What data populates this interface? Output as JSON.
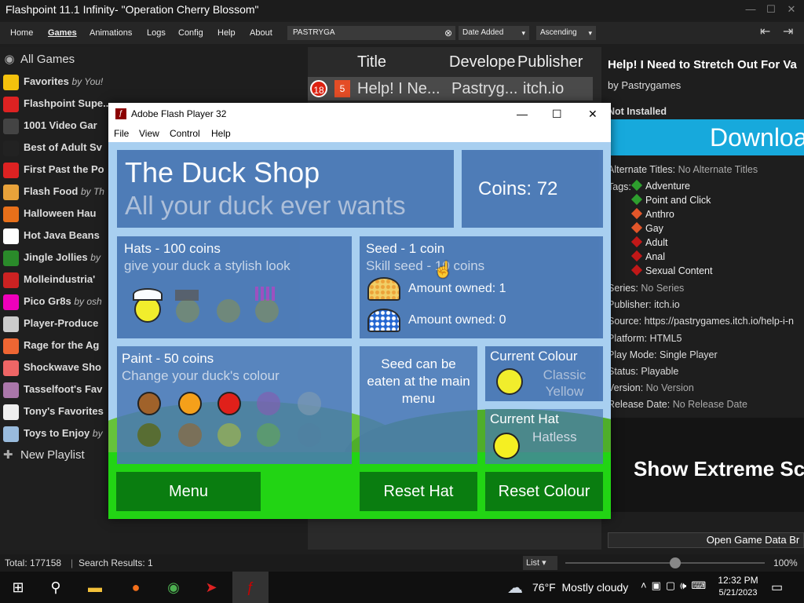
{
  "window": {
    "title": "Flashpoint 11.1 Infinity- \"Operation Cherry Blossom\""
  },
  "menu": {
    "items": [
      "Home",
      "Games",
      "Animations",
      "Logs",
      "Config",
      "Help",
      "About"
    ],
    "active": "Games"
  },
  "search": {
    "value": "PASTRYGA",
    "sort_field": "Date Added",
    "sort_order": "Ascending"
  },
  "sidebar": {
    "all_games": "All Games",
    "new_playlist": "New Playlist",
    "items": [
      {
        "label": "Favorites",
        "by": "by You!"
      },
      {
        "label": "Flashpoint Supe...",
        "by": ""
      },
      {
        "label": "1001 Video Gar",
        "by": ""
      },
      {
        "label": "Best of Adult Sv",
        "by": ""
      },
      {
        "label": "First Past the Po",
        "by": ""
      },
      {
        "label": "Flash Food",
        "by": "by Th"
      },
      {
        "label": "Halloween Hau",
        "by": ""
      },
      {
        "label": "Hot Java Beans",
        "by": ""
      },
      {
        "label": "Jingle Jollies",
        "by": "by"
      },
      {
        "label": "Molleindustria'",
        "by": ""
      },
      {
        "label": "Pico Gr8s",
        "by": "by osh"
      },
      {
        "label": "Player-Produce",
        "by": ""
      },
      {
        "label": "Rage for the Ag",
        "by": ""
      },
      {
        "label": "Shockwave Sho",
        "by": ""
      },
      {
        "label": "Tasselfoot's Fav",
        "by": ""
      },
      {
        "label": "Tony's Favorites",
        "by": ""
      },
      {
        "label": "Toys to Enjoy",
        "by": "by"
      }
    ]
  },
  "list": {
    "columns": [
      "Title",
      "Develope",
      "Publisher"
    ],
    "row": {
      "badge": "18",
      "title": "Help! I Ne...",
      "developer": "Pastryg...",
      "publisher": "itch.io"
    }
  },
  "details": {
    "title": "Help! I Need to Stretch Out For Va",
    "by": "by Pastrygames",
    "status": "Not Installed",
    "download": "Downloa",
    "alt_titles_label": "Alternate Titles:",
    "alt_titles_value": "No Alternate Titles",
    "tags_label": "Tags:",
    "tags": [
      "Adventure",
      "Point and Click",
      "Anthro",
      "Gay",
      "Adult",
      "Anal",
      "Sexual Content"
    ],
    "series_label": "Series:",
    "series_value": "No Series",
    "publisher_label": "Publisher:",
    "publisher_value": "itch.io",
    "source_label": "Source:",
    "source_value": "https://pastrygames.itch.io/help-i-n",
    "platform_label": "Platform:",
    "platform_value": "HTML5",
    "playmode_label": "Play Mode:",
    "playmode_value": "Single Player",
    "status_label": "Status:",
    "status_value": "Playable",
    "version_label": "Version:",
    "version_value": "No Version",
    "release_label": "Release Date:",
    "release_value": "No Release Date",
    "extreme": "Show Extreme Sc",
    "open_data": "Open Game Data Br"
  },
  "statusbar": {
    "total": "Total: 177158",
    "results": "Search Results: 1",
    "view": "List",
    "zoom": "100%",
    "zoom_level": 0.55
  },
  "flash": {
    "title": "Adobe Flash Player 32",
    "menu": [
      "File",
      "View",
      "Control",
      "Help"
    ],
    "shop_title": "The Duck Shop",
    "shop_sub": "All your duck ever wants",
    "coins": "Coins: 72",
    "hats_title": "Hats - 100 coins",
    "hats_sub": "give your duck a stylish look",
    "seed_title": "Seed - 1 coin",
    "seed_sub": "Skill seed - 10 coins",
    "owned1": "Amount owned: 1",
    "owned2": "Amount owned: 0",
    "paint_title": "Paint - 50 coins",
    "paint_sub": "Change your duck's colour",
    "seed_note": "Seed can be eaten at the main menu",
    "cur_colour": "Current Colour",
    "cur_colour_val": "Classic Yellow",
    "cur_hat": "Current Hat",
    "cur_hat_val": "Hatless",
    "btn_menu": "Menu",
    "btn_reset_hat": "Reset Hat",
    "btn_reset_colour": "Reset Colour"
  },
  "taskbar": {
    "weather": "76°F  Mostly cloudy",
    "time": "12:32 PM",
    "date": "5/21/2023"
  }
}
